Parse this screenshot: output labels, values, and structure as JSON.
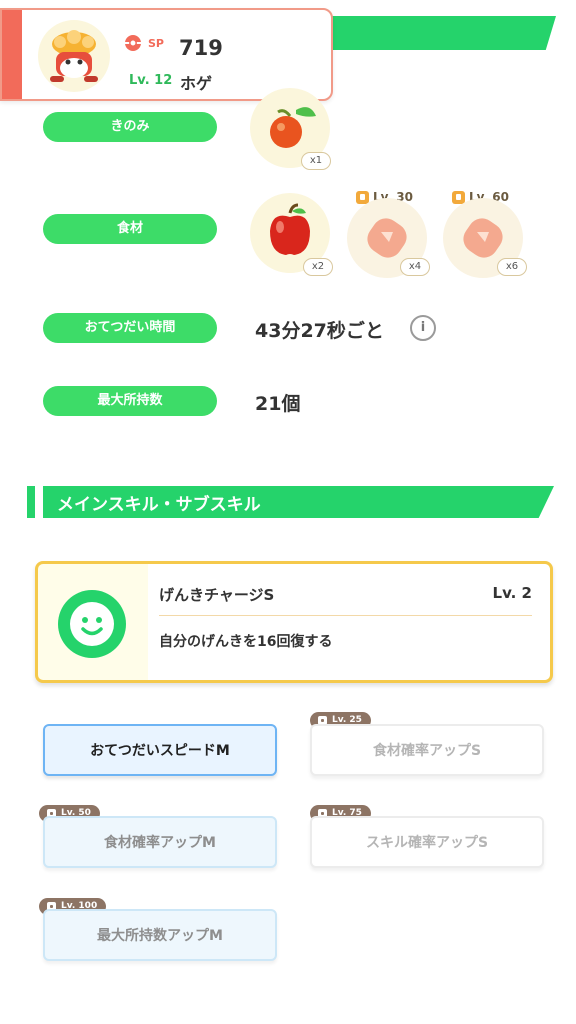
{
  "pokemon": {
    "sp_label": "SP",
    "sp_value": "719",
    "level": "Lv. 12",
    "name": "ホゲ",
    "avatar_icon": "pokemon-avatar-icon"
  },
  "rows": {
    "berry_label": "きのみ",
    "ingredient_label": "食材",
    "help_time_label": "おてつだい時間",
    "max_carry_label": "最大所持数"
  },
  "berry": {
    "icon": "berry-icon",
    "count": "x1"
  },
  "ingredients": [
    {
      "icon": "apple-icon",
      "count": "x2",
      "lock": ""
    },
    {
      "icon": "meat-icon",
      "count": "x4",
      "lock": "Lv. 30"
    },
    {
      "icon": "meat-icon",
      "count": "x6",
      "lock": "Lv. 60"
    }
  ],
  "help_time_value": "43分27秒ごと",
  "info_glyph": "i",
  "max_carry_value": "21個",
  "section_title": "メインスキル・サブスキル",
  "main_skill": {
    "name": "げんきチャージS",
    "level": "Lv. 2",
    "description": "自分のげんきを16回復する"
  },
  "sub_skills": [
    {
      "label": "おてつだいスピードM",
      "lock": ""
    },
    {
      "label": "食材確率アップS",
      "lock": "Lv. 25"
    },
    {
      "label": "食材確率アップM",
      "lock": "Lv. 50"
    },
    {
      "label": "スキル確率アップS",
      "lock": "Lv. 75"
    },
    {
      "label": "最大所持数アップM",
      "lock": "Lv. 100"
    }
  ],
  "colors": {
    "accent_green": "#25d36b",
    "pill_green": "#3ddc68",
    "card_accent": "#f26b5a",
    "skill_border": "#f5c94b"
  }
}
